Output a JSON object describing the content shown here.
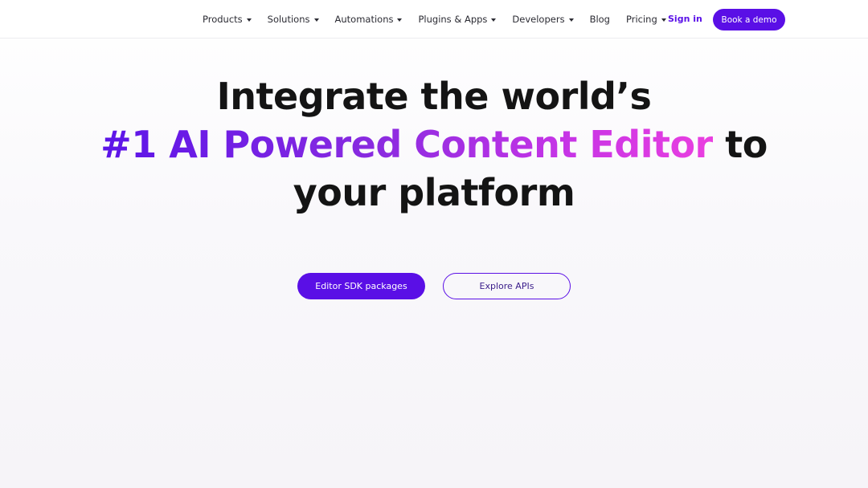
{
  "nav": {
    "items": [
      {
        "label": "Products",
        "dropdown": true
      },
      {
        "label": "Solutions",
        "dropdown": true
      },
      {
        "label": "Automations",
        "dropdown": true
      },
      {
        "label": "Plugins & Apps",
        "dropdown": true
      },
      {
        "label": "Developers",
        "dropdown": true
      },
      {
        "label": "Blog",
        "dropdown": false
      },
      {
        "label": "Pricing",
        "dropdown": true
      }
    ],
    "signin_label": "Sign in",
    "demo_label": "Book a demo"
  },
  "hero": {
    "line1": "Integrate the world’s",
    "line2_highlight": "#1 AI Powered Content Editor",
    "line2_rest": " to",
    "line3": "your platform"
  },
  "cta": {
    "primary_label": "Editor SDK packages",
    "secondary_label": "Explore APIs"
  },
  "colors": {
    "accent": "#5a0fe6",
    "gradient_start": "#5b14e8",
    "gradient_end": "#ea3fe0",
    "text": "#141414"
  }
}
